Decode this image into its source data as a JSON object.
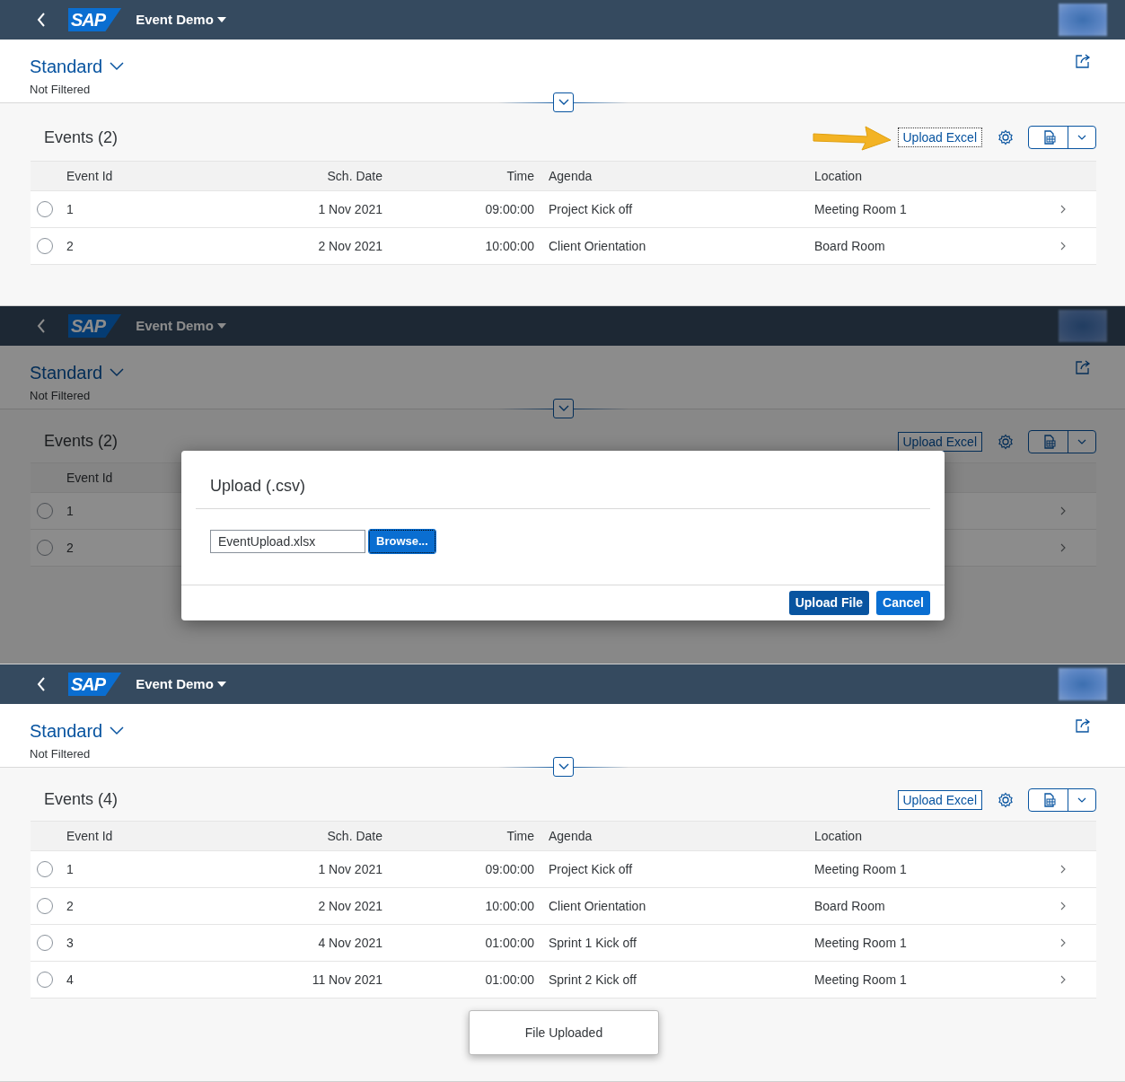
{
  "screens": [
    {
      "header": {
        "logo": "SAP",
        "title": "Event Demo"
      },
      "variant": {
        "name": "Standard",
        "filter_status": "Not Filtered"
      },
      "callout_arrow": true,
      "dimmed": false,
      "table": {
        "title": "Events (2)",
        "upload_button": {
          "label": "Upload Excel",
          "focused": true
        },
        "columns": [
          "Event Id",
          "Sch. Date",
          "Time",
          "Agenda",
          "Location"
        ],
        "rows": [
          {
            "selected": false,
            "cells": [
              "1",
              "1 Nov 2021",
              "09:00:00",
              "Project Kick off",
              "Meeting Room 1"
            ]
          },
          {
            "selected": false,
            "cells": [
              "2",
              "2 Nov 2021",
              "10:00:00",
              "Client Orientation",
              "Board Room"
            ]
          }
        ]
      }
    },
    {
      "header": {
        "logo": "SAP",
        "title": "Event Demo"
      },
      "variant": {
        "name": "Standard",
        "filter_status": "Not Filtered"
      },
      "callout_arrow": false,
      "dimmed": true,
      "table": {
        "title": "Events (2)",
        "upload_button": {
          "label": "Upload Excel",
          "focused": false
        },
        "columns": [
          "Event Id"
        ],
        "rows": [
          {
            "selected": false,
            "cells": [
              "1"
            ]
          },
          {
            "selected": false,
            "cells": [
              "2"
            ]
          }
        ]
      },
      "dialog": {
        "title": "Upload (.csv)",
        "file_value": "EventUpload.xlsx",
        "browse_button": "Browse...",
        "buttons": [
          "Upload File",
          "Cancel"
        ]
      }
    },
    {
      "header": {
        "logo": "SAP",
        "title": "Event Demo"
      },
      "variant": {
        "name": "Standard",
        "filter_status": "Not Filtered"
      },
      "callout_arrow": false,
      "dimmed": false,
      "table": {
        "title": "Events (4)",
        "upload_button": {
          "label": "Upload Excel",
          "focused": false
        },
        "columns": [
          "Event Id",
          "Sch. Date",
          "Time",
          "Agenda",
          "Location"
        ],
        "rows": [
          {
            "selected": false,
            "cells": [
              "1",
              "1 Nov 2021",
              "09:00:00",
              "Project Kick off",
              "Meeting Room 1"
            ]
          },
          {
            "selected": false,
            "cells": [
              "2",
              "2 Nov 2021",
              "10:00:00",
              "Client Orientation",
              "Board Room"
            ]
          },
          {
            "selected": false,
            "cells": [
              "3",
              "4 Nov 2021",
              "01:00:00",
              "Sprint 1 Kick off",
              "Meeting Room 1"
            ]
          },
          {
            "selected": false,
            "cells": [
              "4",
              "11 Nov 2021",
              "01:00:00",
              "Sprint 2 Kick off",
              "Meeting Room 1"
            ]
          }
        ]
      },
      "toast": "File Uploaded"
    }
  ]
}
